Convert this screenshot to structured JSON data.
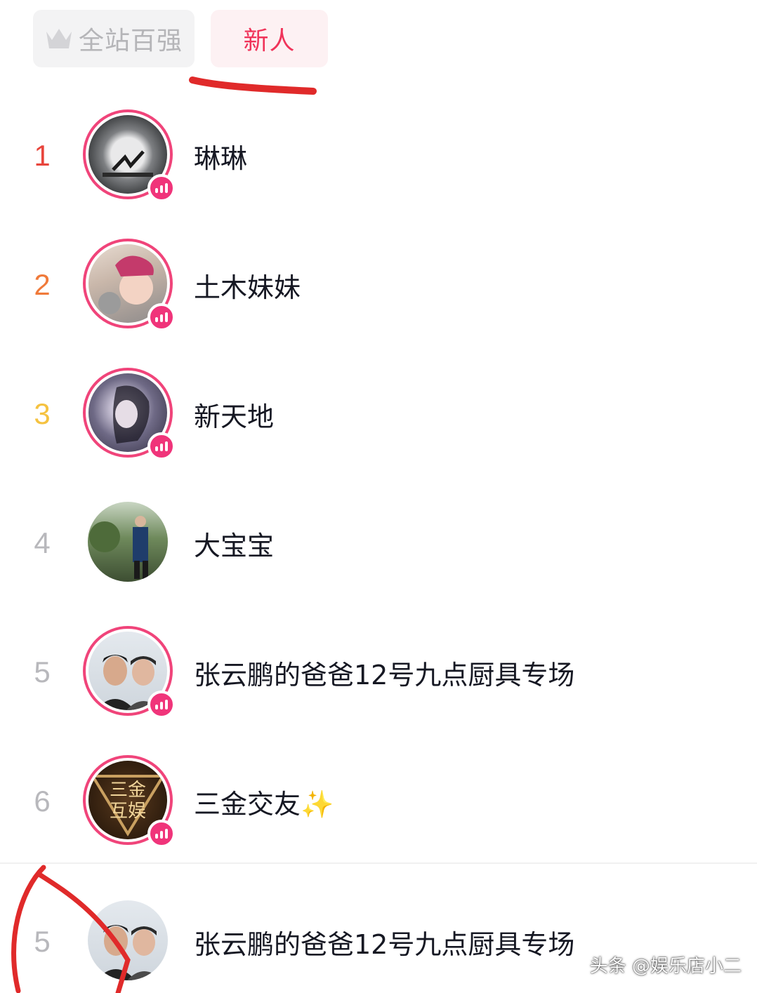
{
  "tabs": {
    "all_label": "全站百强",
    "new_label": "新人"
  },
  "rows": [
    {
      "rank": "1",
      "rank_color": "#e8453c",
      "name": "琳琳",
      "live": true
    },
    {
      "rank": "2",
      "rank_color": "#f07a3a",
      "name": "土木妹妹",
      "live": true
    },
    {
      "rank": "3",
      "rank_color": "#f5c240",
      "name": "新天地",
      "live": true
    },
    {
      "rank": "4",
      "rank_color": "#b8b8bc",
      "name": "大宝宝",
      "live": false
    },
    {
      "rank": "5",
      "rank_color": "#b8b8bc",
      "name": "张云鹏的爸爸12号九点厨具专场",
      "live": true
    },
    {
      "rank": "6",
      "rank_color": "#b8b8bc",
      "name": "三金交友✨",
      "live": true
    }
  ],
  "pinned_row": {
    "rank": "5",
    "name": "张云鹏的爸爸12号九点厨具专场",
    "live": false
  },
  "avatar_texts": {
    "sanjin_line1": "三金",
    "sanjin_line2": "互娱"
  },
  "watermark": "头条 @娱乐店小二",
  "colors": {
    "accent": "#f0345a",
    "live_badge": "#f0347a",
    "annotation_red": "#e02a2a"
  }
}
